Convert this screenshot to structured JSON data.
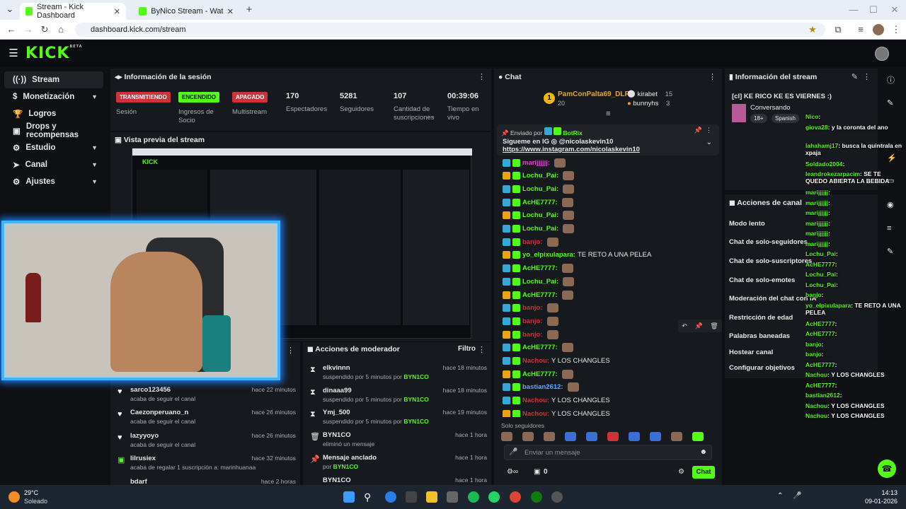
{
  "browser": {
    "tabs": [
      {
        "label": "Stream - Kick Dashboard",
        "active": true
      },
      {
        "label": "ByNico Stream - Watch Live on",
        "active": false
      }
    ],
    "url": "dashboard.kick.com/stream"
  },
  "brand": {
    "logo": "KICK",
    "logo_sup": "BETA",
    "accent": "#53fc18"
  },
  "nav": {
    "items": [
      {
        "label": "Stream",
        "icon": "broadcast-icon",
        "active": true
      },
      {
        "label": "Monetización",
        "icon": "dollar-icon",
        "chevron": true
      },
      {
        "label": "Logros",
        "icon": "trophy-icon"
      },
      {
        "label": "Drops y recompensas",
        "icon": "gift-icon"
      },
      {
        "label": "Estudio",
        "icon": "studio-icon",
        "chevron": true
      },
      {
        "label": "Canal",
        "icon": "channel-icon",
        "chevron": true
      },
      {
        "label": "Ajustes",
        "icon": "gear-icon",
        "chevron": true
      }
    ]
  },
  "session": {
    "title": "Información de la sesión",
    "stats": [
      {
        "badge": "TRANSMITIENDO",
        "badge_color": "#d0323a",
        "label": "Sesión"
      },
      {
        "badge": "ENCENDIDO",
        "badge_color": "#53fc18",
        "label": "Ingresos de Socio"
      },
      {
        "badge": "APAGADO",
        "badge_color": "#d0323a",
        "label": "Multistream"
      },
      {
        "value": "170",
        "label": "Espectadores"
      },
      {
        "value": "5281",
        "label": "Seguidores"
      },
      {
        "value": "107",
        "label": "Cantidad de suscripciones"
      },
      {
        "value": "00:39:06",
        "label": "Tiempo en vivo"
      }
    ]
  },
  "preview": {
    "title": "Vista previa del stream"
  },
  "activity": {
    "items": [
      {
        "user": "sarco123456",
        "action": "acaba de seguir el canal",
        "time": "hace 22 minutos"
      },
      {
        "user": "Caezonperuano_n",
        "action": "acaba de seguir el canal",
        "time": "hace 26 minutos"
      },
      {
        "user": "lazyyoyo",
        "action": "acaba de seguir el canal",
        "time": "hace 26 minutos"
      },
      {
        "user": "lilrusiex",
        "action": "acaba de regalar 1 suscripción a: marinhuanaa",
        "time": "hace 32 minutos"
      },
      {
        "user": "bdarf",
        "action": "",
        "time": "hace 2 horas"
      }
    ]
  },
  "mod_actions": {
    "title": "Acciones de moderador",
    "filter": "Filtro",
    "items": [
      {
        "user": "elkvinnn",
        "action": "suspendido por 5 minutos por",
        "by": "BYN1CO",
        "time": "hace 18 minutos"
      },
      {
        "user": "dinaaa99",
        "action": "suspendido por 5 minutos por",
        "by": "BYN1CO",
        "time": "hace 18 minutos"
      },
      {
        "user": "Ymj_500",
        "action": "suspendido por 5 minutos por",
        "by": "BYN1CO",
        "time": "hace 19 minutos"
      },
      {
        "user": "BYN1CO",
        "action": "eliminó un mensaje",
        "by": "",
        "time": "hace 1 hora"
      },
      {
        "user": "Mensaje anclado",
        "action": "por",
        "by": "BYN1CO",
        "time": "hace 1 hora"
      },
      {
        "user": "BYN1CO",
        "action": "",
        "by": "",
        "time": "hace 1 hora"
      }
    ]
  },
  "chat": {
    "title": "Chat",
    "top_gifter": {
      "name": "PamConPalta69_DLFR",
      "count": "20"
    },
    "gifters": [
      {
        "name": "kirabet",
        "count": "15"
      },
      {
        "name": "bunnyhs",
        "count": "3"
      }
    ],
    "pinned": {
      "sent_by_label": "Enviado por",
      "sender": "BotRix",
      "line1": "Sigueme en IG",
      "handle": "@nicolaskevin10",
      "link": "https://www.instagram.com/nicolaskevin10"
    },
    "messages": [
      {
        "user": "marijjjjjj:",
        "text": "",
        "color": "pink"
      },
      {
        "user": "Lochu_Pai:",
        "text": "",
        "color": "green"
      },
      {
        "user": "Lochu_Pai:",
        "text": "",
        "color": "green"
      },
      {
        "user": "AcHE7777:",
        "text": "",
        "color": "green"
      },
      {
        "user": "Lochu_Pai:",
        "text": "",
        "color": "green"
      },
      {
        "user": "Lochu_Pai:",
        "text": "",
        "color": "green"
      },
      {
        "user": "banjo:",
        "text": "",
        "color": "red"
      },
      {
        "user": "yo_elpixulapara:",
        "text": "TE RETO A UNA PELEA",
        "color": "green"
      },
      {
        "user": "AcHE7777:",
        "text": "",
        "color": "green"
      },
      {
        "user": "Lochu_Pai:",
        "text": "",
        "color": "green"
      },
      {
        "user": "AcHE7777:",
        "text": "",
        "color": "green"
      },
      {
        "user": "banjo:",
        "text": "",
        "color": "red"
      },
      {
        "user": "banjo:",
        "text": "",
        "color": "red"
      },
      {
        "user": "banjo:",
        "text": "",
        "color": "red"
      },
      {
        "user": "AcHE7777:",
        "text": "",
        "color": "green"
      },
      {
        "user": "Nachou:",
        "text": "Y LOS CHANGLES",
        "color": "red"
      },
      {
        "user": "AcHE7777:",
        "text": "",
        "color": "green"
      },
      {
        "user": "bastian2612:",
        "text": "",
        "color": "blue"
      },
      {
        "user": "Nachou:",
        "text": "Y LOS CHANGLES",
        "color": "red"
      },
      {
        "user": "Nachou:",
        "text": "Y LOS CHANGLES",
        "color": "red"
      }
    ],
    "followers_only": "Solo seguidores",
    "input_placeholder": "Enviar un mensaje",
    "viewer_count": "0",
    "send_label": "Chat"
  },
  "stream_info": {
    "title": "Información del stream",
    "stream_title": "[cl] KE RICO KE ES VIERNES :)",
    "category": "Conversando",
    "tags": [
      "18+",
      "Spanish"
    ]
  },
  "channel_actions": {
    "title": "Acciones de canal",
    "items": [
      "Modo lento",
      "Chat de solo-seguidores",
      "Chat de solo-suscriptores",
      "Chat de solo-emotes",
      "Moderación del chat con IA",
      "Restricción de edad",
      "Palabras baneadas",
      "Hostear canal",
      "Configurar objetivos"
    ]
  },
  "overlay_chat": [
    {
      "user": "Nico",
      "text": ""
    },
    {
      "user": "giova28",
      "text": "y la coronta del ano"
    },
    {
      "user": "lahahamj17",
      "text": "busca la quintrala en xpaja"
    },
    {
      "user": "Soldado2004",
      "text": ""
    },
    {
      "user": "leandrokezarpacim",
      "text": "SE TE QUEDO ABIERTA LA BEBIDA"
    },
    {
      "user": "marijjjjjj",
      "text": ""
    },
    {
      "user": "marijjjjjj",
      "text": ""
    },
    {
      "user": "marijjjjjj",
      "text": ""
    },
    {
      "user": "marijjjjjj",
      "text": ""
    },
    {
      "user": "marijjjjjj",
      "text": ""
    },
    {
      "user": "marijjjjjj",
      "text": ""
    },
    {
      "user": "Lochu_Pai",
      "text": ""
    },
    {
      "user": "AcHE7777",
      "text": ""
    },
    {
      "user": "Lochu_Pai",
      "text": ""
    },
    {
      "user": "Lochu_Pai",
      "text": ""
    },
    {
      "user": "banjo",
      "text": ""
    },
    {
      "user": "yo_elpixulapara",
      "text": "TE RETO A UNA PELEA"
    },
    {
      "user": "AcHE7777",
      "text": ""
    },
    {
      "user": "AcHE7777",
      "text": ""
    },
    {
      "user": "banjo",
      "text": ""
    },
    {
      "user": "banjo",
      "text": ""
    },
    {
      "user": "AcHE7777",
      "text": ""
    },
    {
      "user": "Nachou",
      "text": "Y LOS CHANGLES"
    },
    {
      "user": "AcHE7777",
      "text": ""
    },
    {
      "user": "bastian2612",
      "text": ""
    },
    {
      "user": "Nachou",
      "text": "Y LOS CHANGLES"
    },
    {
      "user": "Nachou",
      "text": "Y LOS CHANGLES"
    }
  ],
  "taskbar": {
    "weather_temp": "29°C",
    "weather_desc": "Soleado",
    "time": "14:13",
    "date": "09-01-2026"
  }
}
